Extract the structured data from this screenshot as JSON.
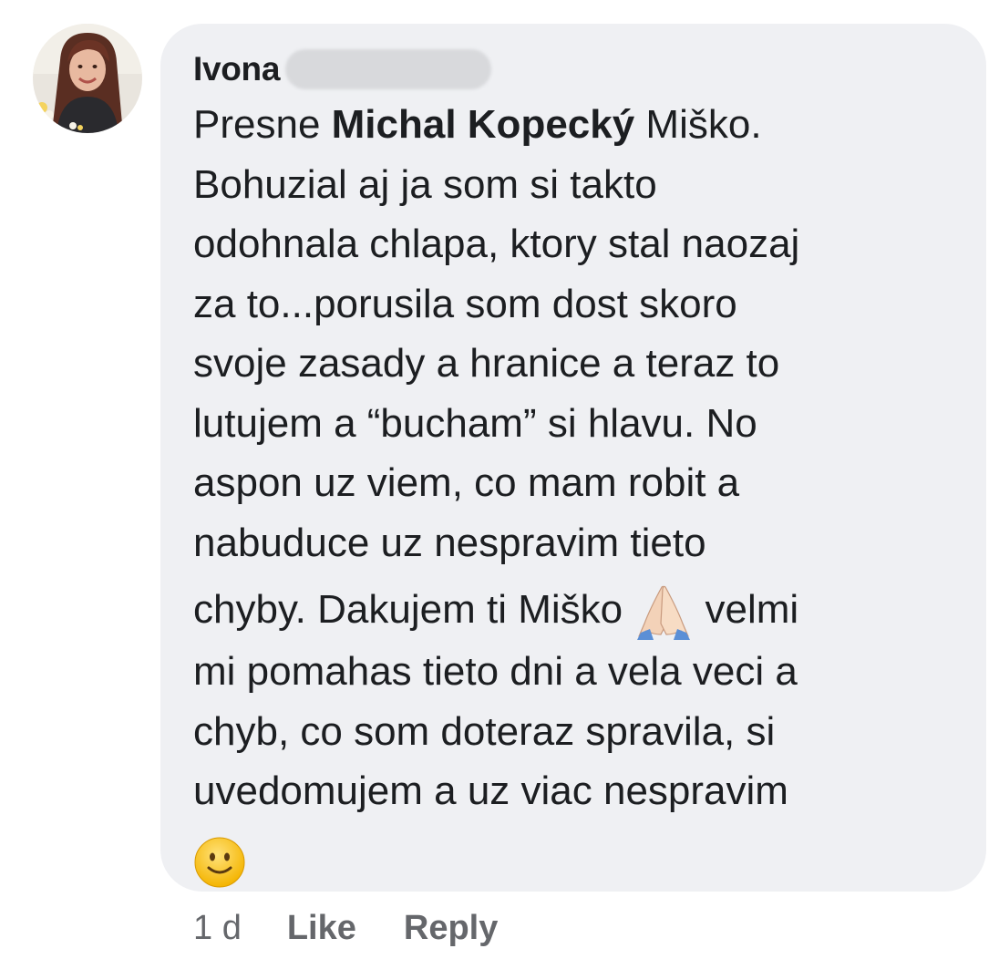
{
  "comment": {
    "author": "Ivona",
    "body_lines": [
      {
        "before": "Presne ",
        "mention": "Michal Kopecký",
        "after": " Miško."
      },
      {
        "text": "Bohuzial aj ja som si takto"
      },
      {
        "text": "odohnala chlapa, ktory  stal naozaj"
      },
      {
        "text": "za to...porusila som dost skoro"
      },
      {
        "text": "svoje zasady a hranice a teraz to"
      },
      {
        "text": "lutujem a “bucham” si hlavu. No"
      },
      {
        "text": "aspon uz viem, co mam robit a"
      },
      {
        "text": "nabuduce uz nespravim tieto"
      },
      {
        "before": "chyby. Dakujem ti Miško ",
        "after": " velmi"
      },
      {
        "text": "mi pomahas tieto dni a vela veci a"
      },
      {
        "text": "chyb, co som doteraz spravila, si"
      },
      {
        "text": "uvedomujem a uz viac nespravim"
      }
    ],
    "emojis": [
      "folded-hands",
      "slightly-smiling-face"
    ]
  },
  "meta": {
    "time": "1 d",
    "like_label": "Like",
    "reply_label": "Reply"
  },
  "colors": {
    "bubble": "#eff0f3",
    "text": "#1c1e21",
    "meta": "#65676b"
  }
}
